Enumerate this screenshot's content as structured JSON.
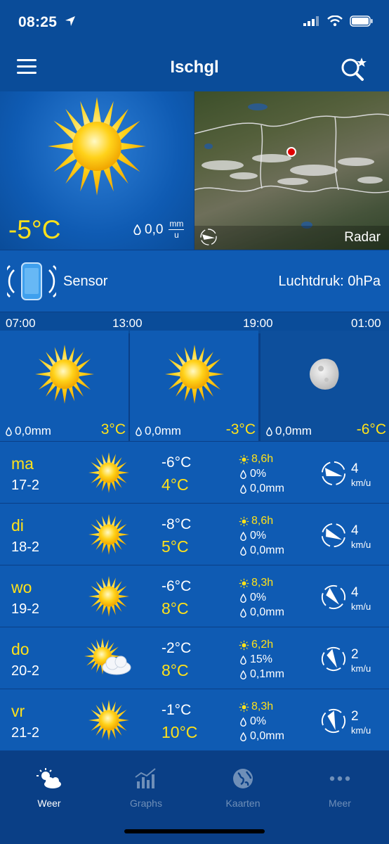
{
  "status": {
    "time": "08:25"
  },
  "header": {
    "title": "Ischgl"
  },
  "current": {
    "temperature": "-5°C",
    "precipitation": "0,0",
    "precip_unit_top": "mm",
    "precip_unit_bottom": "u",
    "radar_label": "Radar"
  },
  "sensor": {
    "label": "Sensor",
    "pressure": "Luchtdruk: 0hPa"
  },
  "hourly": {
    "times": [
      "07:00",
      "13:00",
      "19:00",
      "01:00"
    ],
    "blocks": [
      {
        "icon": "sun-icon",
        "precip": "0,0mm",
        "temp": "3°C"
      },
      {
        "icon": "sun-icon",
        "precip": "0,0mm",
        "temp": "-3°C"
      },
      {
        "icon": "moon-icon",
        "precip": "0,0mm",
        "temp": "-6°C"
      }
    ]
  },
  "days": [
    {
      "name": "ma",
      "date": "17-2",
      "icon": "sun-icon",
      "tmin": "-6°C",
      "tmax": "4°C",
      "sun_hours": "8,6h",
      "precip_chance": "0%",
      "precip_amount": "0,0mm",
      "wind_speed": "4",
      "wind_unit": "km/u"
    },
    {
      "name": "di",
      "date": "18-2",
      "icon": "sun-icon",
      "tmin": "-8°C",
      "tmax": "5°C",
      "sun_hours": "8,6h",
      "precip_chance": "0%",
      "precip_amount": "0,0mm",
      "wind_speed": "4",
      "wind_unit": "km/u"
    },
    {
      "name": "wo",
      "date": "19-2",
      "icon": "sun-icon",
      "tmin": "-6°C",
      "tmax": "8°C",
      "sun_hours": "8,3h",
      "precip_chance": "0%",
      "precip_amount": "0,0mm",
      "wind_speed": "4",
      "wind_unit": "km/u"
    },
    {
      "name": "do",
      "date": "20-2",
      "icon": "sun-cloud-icon",
      "tmin": "-2°C",
      "tmax": "8°C",
      "sun_hours": "6,2h",
      "precip_chance": "15%",
      "precip_amount": "0,1mm",
      "wind_speed": "2",
      "wind_unit": "km/u"
    },
    {
      "name": "vr",
      "date": "21-2",
      "icon": "sun-icon",
      "tmin": "-1°C",
      "tmax": "10°C",
      "sun_hours": "8,3h",
      "precip_chance": "0%",
      "precip_amount": "0,0mm",
      "wind_speed": "2",
      "wind_unit": "km/u"
    }
  ],
  "tabs": [
    {
      "label": "Weer",
      "icon": "weather-icon",
      "active": true
    },
    {
      "label": "Graphs",
      "icon": "graphs-icon",
      "active": false
    },
    {
      "label": "Kaarten",
      "icon": "globe-icon",
      "active": false
    },
    {
      "label": "Meer",
      "icon": "more-icon",
      "active": false
    }
  ],
  "colors": {
    "accent": "#ffe11a",
    "background": "#0f5bb3",
    "header": "#0a4c99"
  }
}
